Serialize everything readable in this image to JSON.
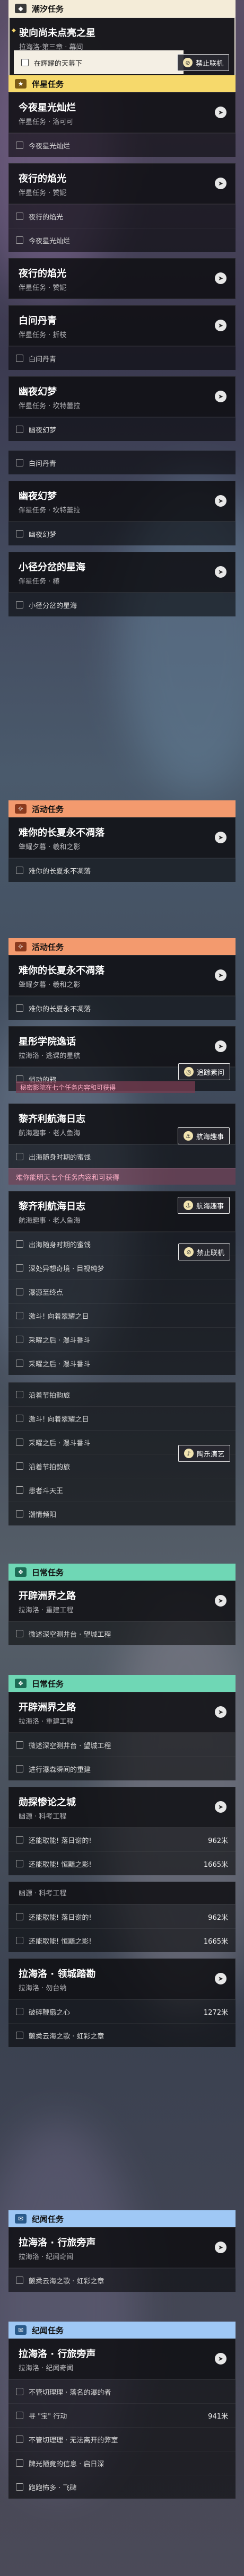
{
  "colors": {
    "tide": "#f4ecd8",
    "companion": "#f6d96b",
    "activity": "#f39a6e",
    "pioneer": "#6fd7b5",
    "trail": "#d8dde8",
    "travel": "#9fc8f5"
  },
  "sec1": {
    "label": "潮汐任务"
  },
  "q1": {
    "title": "驶向尚未点亮之星",
    "sub": "拉海洛·第三章 · 幕间",
    "step": "在辉耀的天幕下",
    "chip": "禁止联机"
  },
  "sec2": {
    "label": "伴星任务"
  },
  "q2": {
    "title": "今夜星光灿烂",
    "sub": "伴星任务 · 洛可可",
    "step": "今夜星光灿烂"
  },
  "q3": {
    "title": "夜行的焰光",
    "sub": "伴星任务 · 赞妮",
    "step": "夜行的焰光"
  },
  "q4": {
    "title": "夜行的焰光",
    "sub": "伴星任务 · 赞妮",
    "step": "今夜星光灿烂"
  },
  "q5": {
    "title": "白问丹青",
    "sub": "伴星任务 · 折枝",
    "step": "白问丹青"
  },
  "q6": {
    "title": "幽夜幻梦",
    "sub": "伴星任务 · 坎特蕾拉",
    "step1": "幽夜幻梦",
    "step2": "白问丹青"
  },
  "q7": {
    "title": "幽夜幻梦",
    "sub": "伴星任务 · 坎特蕾拉",
    "step": "幽夜幻梦"
  },
  "q8": {
    "title": "小径分岔的星海",
    "sub": "伴星任务 · 椿",
    "step": "小径分岔的星海"
  },
  "sec3": {
    "label": "活动任务"
  },
  "q9": {
    "title": "难你的长夏永不凋落",
    "sub": "肇耀夕暮 · 羲和之影",
    "step": "难你的长夏永不凋落"
  },
  "sec4": {
    "label": "活动任务"
  },
  "q10": {
    "title": "难你的长夏永不凋落",
    "sub": "肇耀夕暮 · 羲和之影",
    "step": "难你的长夏永不凋落"
  },
  "q11": {
    "title": "星彤学院逸话",
    "sub": "拉海洛 · 逃课的星航",
    "step": "悄动的鸦",
    "chip": "追踪素问",
    "toast": "秘密影院在七个任务内容和可获得"
  },
  "q12": {
    "title": "黎齐利航海日志",
    "sub": "航海趣事 · 老人鱼海",
    "step1": "出海随身时期的蜜饯",
    "step2": "难你能明天七个任务内容和可获得",
    "chip": "航海趣事"
  },
  "q13": {
    "title": "黎齐利航海日志",
    "sub": "航海趣事 · 老人鱼海",
    "chip": "航海趣事",
    "steps": [
      "出海随身时期的蜜饯",
      "深处异想奇境 · 目视纯梦",
      "瀑源至终点",
      "激斗! 向着翠耀之日",
      "采曜之后 · 瀑斗番斗",
      "采曜之后 · 瀑斗番斗"
    ],
    "chip2": "禁止联机"
  },
  "q13b": {
    "steps": [
      "沿着节拍韵旅",
      "激斗! 向着翠耀之日",
      "采曜之后 · 瀑斗番斗",
      "沿着节拍韵旅",
      "患者斗天王",
      "潮情频阳"
    ],
    "chip": "陶乐演艺"
  },
  "sec5": {
    "label": "日常任务"
  },
  "q14": {
    "title": "开辟洲界之路",
    "sub": "拉海洛 · 重建工程",
    "step": "微述深空测井台 · 望城工程"
  },
  "sec6": {
    "label": "日常任务"
  },
  "q15": {
    "title": "开辟洲界之路",
    "sub": "拉海洛 · 重建工程",
    "step1": "微述深空测井台 · 望城工程",
    "step2": "进行瀑森瞬间的重建"
  },
  "q16": {
    "title": "勋探惨论之城",
    "sub": "幽源 · 科考工程",
    "steps": [
      {
        "t": "还能取能! 落日谢的!",
        "d": "962米"
      },
      {
        "t": "还能取能! 恒黯之影!",
        "d": "1665米"
      }
    ]
  },
  "q17": {
    "title": "拉海洛 · 领城踏勘",
    "sub": "拉海洛 · 勿台纳",
    "pre": "幽源 · 科考工程",
    "steps": [
      {
        "t": "还能取能! 落日谢的!",
        "d": "962米"
      },
      {
        "t": "还能取能! 恒黯之影!",
        "d": "1665米"
      },
      {
        "t": "破碎鞭扇之心",
        "d": "1272米"
      },
      {
        "t": "颤柔云海之歌 · 虹彩之章",
        "d": ""
      }
    ]
  },
  "sec7": {
    "label": "纪闻任务"
  },
  "q18": {
    "title": "拉海洛 · 行旅旁声",
    "sub": "拉海洛 · 纪闻奇闻",
    "step": "颤柔云海之歌 · 虹彩之章"
  },
  "sec8": {
    "label": "纪闻任务"
  },
  "q19": {
    "title": "拉海洛 · 行旅旁声",
    "sub": "拉海洛 · 纪闻奇闻"
  },
  "q20": {
    "title": "拉海洛 · 行旅旁声",
    "sub": "拉海洛 · 纪闻奇闻",
    "steps": [
      {
        "t": "不管切理理 · 落名的瀑的者",
        "d": ""
      },
      {
        "t": "寻 \"宝\" 行动",
        "d": "941米"
      },
      {
        "t": "不管切理理 · 无法离开的弊室",
        "d": ""
      },
      {
        "t": "牌光陋竟的信息 · 启日深",
        "d": ""
      },
      {
        "t": "跑跑怖多 · 飞碑",
        "d": ""
      }
    ]
  }
}
